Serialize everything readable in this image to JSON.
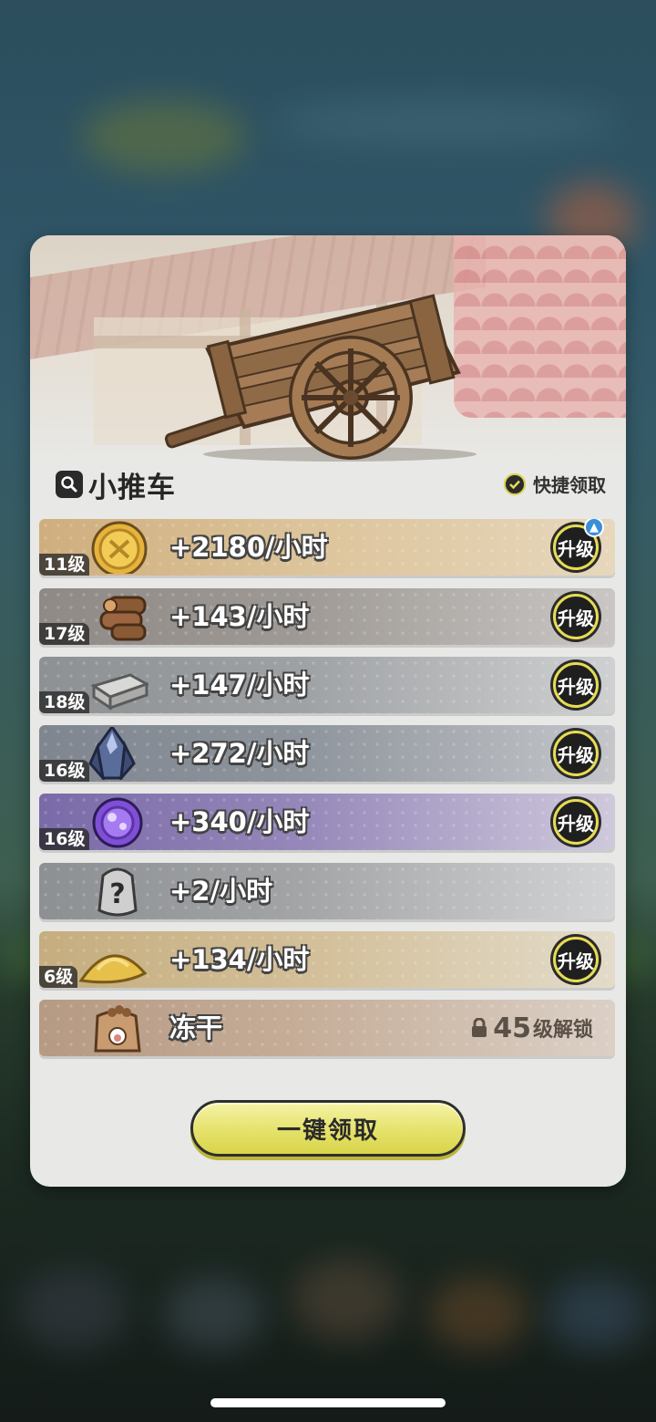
{
  "panel": {
    "title": "小推车",
    "quick_claim_label": "快捷领取",
    "claim_all_label": "一键领取"
  },
  "rows": [
    {
      "level": "11级",
      "rate": "+2180/小时",
      "action": "升级",
      "icon": "gold-coin-icon",
      "has_notice": true
    },
    {
      "level": "17级",
      "rate": "+143/小时",
      "action": "升级",
      "icon": "wood-logs-icon"
    },
    {
      "level": "18级",
      "rate": "+147/小时",
      "action": "升级",
      "icon": "stone-bricks-icon"
    },
    {
      "level": "16级",
      "rate": "+272/小时",
      "action": "升级",
      "icon": "crystal-ore-icon"
    },
    {
      "level": "16级",
      "rate": "+340/小时",
      "action": "升级",
      "icon": "purple-orb-icon"
    },
    {
      "level": "",
      "rate": "+2/小时",
      "action": "",
      "icon": "mystery-item-icon"
    },
    {
      "level": "6级",
      "rate": "+134/小时",
      "action": "升级",
      "icon": "sand-pile-icon"
    },
    {
      "level": "",
      "rate": "冻干",
      "action": "",
      "icon": "treat-bag-icon",
      "locked": true,
      "unlock_level": "45",
      "unlock_suffix": "级解锁"
    }
  ],
  "colors": {
    "button_yellow": "#e5e26b",
    "upgrade_ring": "#e6dc55",
    "row_gold": "#d8bd8f",
    "row_purple": "#8a78b5"
  }
}
